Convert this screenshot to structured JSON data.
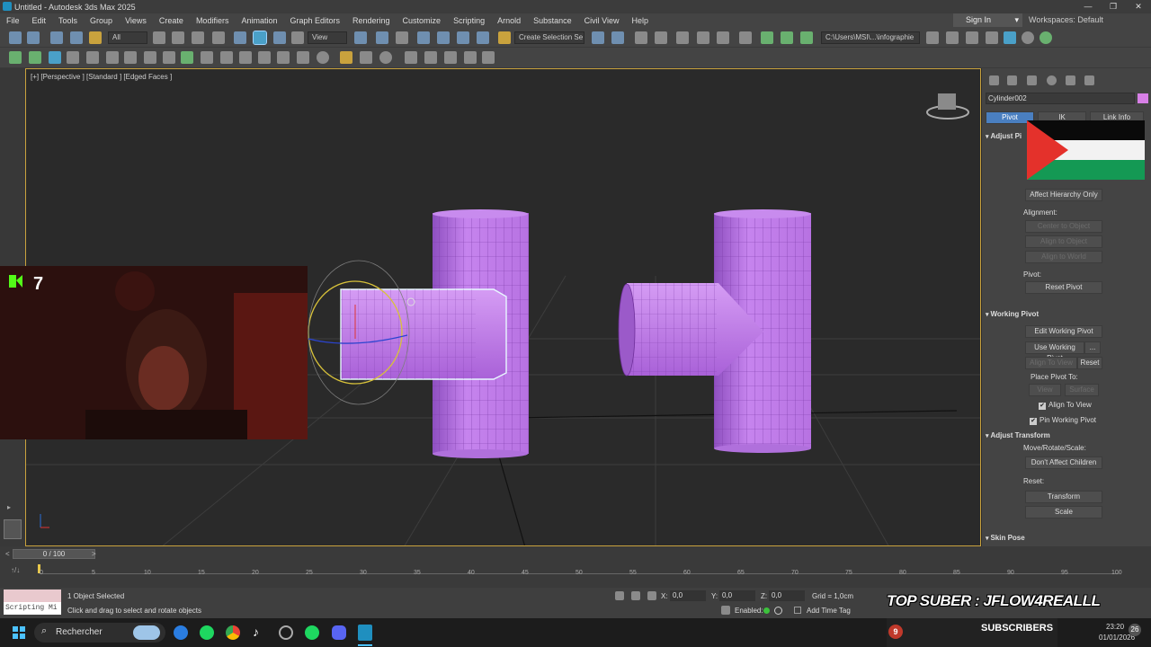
{
  "window": {
    "title": "Untitled - Autodesk 3ds Max 2025"
  },
  "menus": [
    "File",
    "Edit",
    "Tools",
    "Group",
    "Views",
    "Create",
    "Modifiers",
    "Animation",
    "Graph Editors",
    "Rendering",
    "Customize",
    "Scripting",
    "Arnold",
    "Substance",
    "Civil View",
    "Help"
  ],
  "account": {
    "sign_in": "Sign In",
    "workspaces": "Workspaces: Default"
  },
  "toolbar": {
    "selection_filter": "All",
    "ref_coord": "View",
    "named_selection": "Create Selection Se",
    "project_path": "C:\\Users\\MSI\\...\\infographie"
  },
  "viewport": {
    "label": "[+] [Perspective ] [Standard ] [Edged Faces ]",
    "selected_color": "#c08adf"
  },
  "command_panel": {
    "object_name": "Cylinder002",
    "object_color": "#d77fe6",
    "tabs": [
      "Pivot",
      "IK",
      "Link Info"
    ],
    "adjust_pivot": {
      "title": "Adjust Pi",
      "affect_hierarchy": "Affect Hierarchy Only",
      "alignment_label": "Alignment:",
      "center_to_object": "Center to Object",
      "align_to_object": "Align to Object",
      "align_to_world": "Align to World",
      "pivot_label": "Pivot:",
      "reset_pivot": "Reset Pivot"
    },
    "working_pivot": {
      "title": "Working Pivot",
      "edit": "Edit Working Pivot",
      "use": "Use Working Pivot",
      "use_more": "...",
      "align_to_view": "Align To View",
      "reset": "Reset",
      "place_pivot_to": "Place Pivot To:",
      "view": "View",
      "surface": "Surface",
      "chk_align_to_view": "Align To View",
      "chk_pin": "Pin Working Pivot"
    },
    "adjust_transform": {
      "title": "Adjust Transform",
      "move_rotate_scale": "Move/Rotate/Scale:",
      "dont_affect_children": "Don't Affect Children",
      "reset_label": "Reset:",
      "transform": "Transform",
      "scale": "Scale"
    },
    "skin_pose": {
      "title": "Skin Pose"
    }
  },
  "timeline": {
    "frame_indicator": "0 / 100",
    "ticks": [
      "0",
      "5",
      "10",
      "15",
      "20",
      "25",
      "30",
      "35",
      "40",
      "45",
      "50",
      "55",
      "60",
      "65",
      "70",
      "75",
      "80",
      "85",
      "90",
      "95",
      "100"
    ]
  },
  "status": {
    "selected": "1 Object Selected",
    "prompt": "Click and drag to select and rotate objects",
    "script_label": "Scripting Mi",
    "x_label": "X:",
    "x_value": "0,0",
    "y_label": "Y:",
    "y_value": "0,0",
    "z_label": "Z:",
    "z_value": "0,0",
    "grid": "Grid = 1,0cm",
    "enabled": "Enabled:",
    "add_time_tag": "Add Time Tag",
    "overlay_banner": "TOP SUBER : JFLOW4REALLL"
  },
  "webcam": {
    "badge_number": "7"
  },
  "taskbar": {
    "search_placeholder": "Rechercher",
    "subscribers_label": "SUBSCRIBERS",
    "subscribers_count": "9",
    "time": "23:20",
    "date": "01/01/2026"
  }
}
